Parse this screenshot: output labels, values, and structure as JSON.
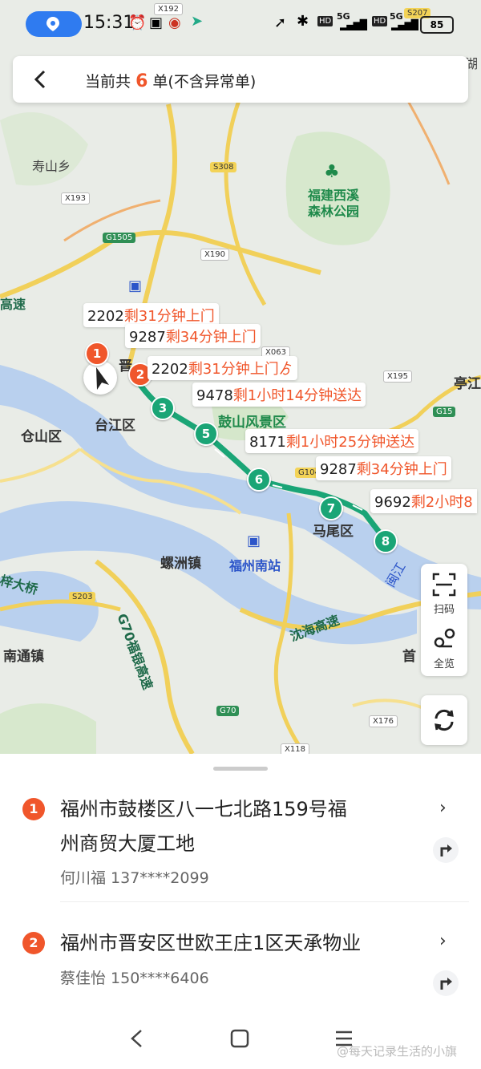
{
  "status_bar": {
    "time": "15:31",
    "network_1": "5G",
    "network_2": "5G",
    "battery": "85",
    "road_badges": [
      "X192",
      "S207"
    ]
  },
  "header": {
    "prefix": "当前共",
    "count": "6",
    "suffix": "单(不含异常单)"
  },
  "map": {
    "labels": {
      "shoushan": "寿山乡",
      "forest_park_line1": "福建西溪",
      "forest_park_line2": "森林公园",
      "cangshan": "仓山区",
      "taijiang": "台江区",
      "jinan_partial": "晋",
      "gushan": "鼓山风景区",
      "mawei": "马尾区",
      "luozhou": "螺洲镇",
      "fuzhou_south": "福州南站",
      "nantong": "南通镇",
      "tinghu": "亭江",
      "shenhai": "沈海高速",
      "fuyin": "G70福银高速",
      "gaosu_left": "高速",
      "wuyi_bridge": "梓大桥",
      "minjiang": "闽江",
      "shou": "首",
      "hu_top": "湖"
    },
    "road_badges": [
      "S308",
      "X193",
      "G1505",
      "X190",
      "X063",
      "X195",
      "G15",
      "G104",
      "S203",
      "G70",
      "X176",
      "X118"
    ],
    "markers": [
      "1",
      "2",
      "3",
      "5",
      "6",
      "7",
      "8"
    ],
    "etas": [
      {
        "id": "2202",
        "time": "剩31分钟上门"
      },
      {
        "id": "9287",
        "time": "剩34分钟上门"
      },
      {
        "id": "2202",
        "time": "剩31分钟上门"
      },
      {
        "id": "9478",
        "time": "剩1小时14分钟送达"
      },
      {
        "id": "8171",
        "time": "剩1小时25分钟送达"
      },
      {
        "id": "9287",
        "time": "剩34分钟上门"
      },
      {
        "id": "9692",
        "time": "剩2小时8"
      }
    ],
    "eta_clip": "ゟ"
  },
  "side_buttons": {
    "scan": "扫码",
    "overview": "全览"
  },
  "orders": [
    {
      "num": "1",
      "address_line1": "福州市鼓楼区八一七北路159号福",
      "address_line2": "州商贸大厦工地",
      "contact": "何川福 137****2099"
    },
    {
      "num": "2",
      "address_line1": "福州市晋安区世欧王庄1区天承物业",
      "contact": "蔡佳怡 150****6406"
    }
  ],
  "watermark": "@每天记录生活的小旗"
}
